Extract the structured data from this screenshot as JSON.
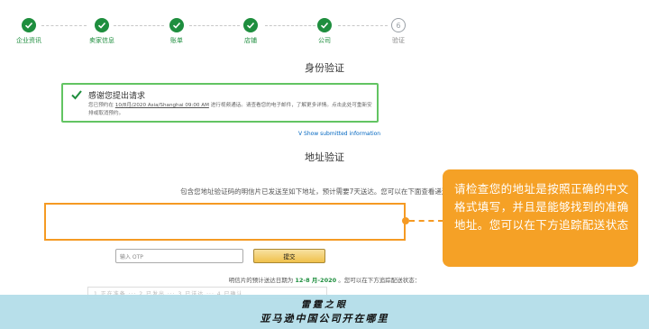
{
  "steps": [
    {
      "label": "企业资讯"
    },
    {
      "label": "卖家信息"
    },
    {
      "label": "账单"
    },
    {
      "label": "店铺"
    },
    {
      "label": "公司"
    },
    {
      "label": "验证",
      "number": "6"
    }
  ],
  "identity": {
    "heading": "身份验证",
    "alert_title": "感谢您提出请求",
    "alert_body_prefix": "您已预约在",
    "alert_date": "10/8月/2020 Asia/Shanghai 09:00 AM",
    "alert_body_suffix": "进行视频通话。请查看您的电子邮件，了解更多详情。点击此处可重新安排或取消预约。",
    "show_link": "V Show submitted information"
  },
  "address": {
    "heading": "地址验证",
    "info": "包含您地址验证码的明信片已发送至如下地址，预计需要7天送达。您可以在下面查看递送状态。",
    "otp_placeholder": "输入 OTP",
    "submit_label": "提交",
    "due_prefix": "明信片的预计送达日期为",
    "due_date": "12-8 月-2020",
    "due_suffix": "。您可以在下方追踪配送状态：",
    "track_items": "1 正在准备 ··· 2 已发出 ··· 3 已送达 ··· 4 已确认"
  },
  "callout": {
    "text": "请检查您的地址是按照正确的中文格式填写，并且是能够找到的准确地址。您可以在下方追踪配送状态"
  },
  "banner": {
    "line1": "雷霆之眼",
    "line2": "亚马逊中国公司开在哪里"
  }
}
